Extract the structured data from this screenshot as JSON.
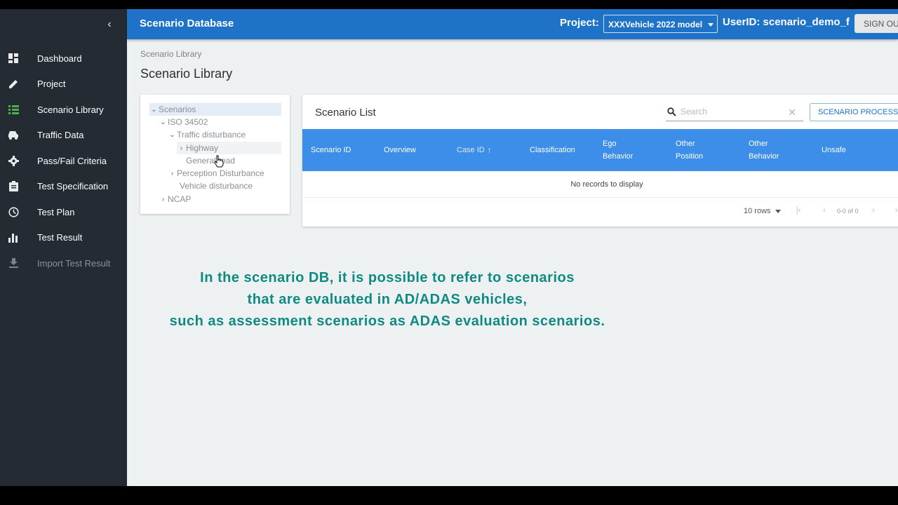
{
  "app": {
    "title": "Scenario Database"
  },
  "header": {
    "project_label": "Project:",
    "project_value": "XXXVehicle 2022 model",
    "user_id": "UserID: scenario_demo_f",
    "signout_label": "SIGN OUT"
  },
  "sidebar": {
    "collapse_icon": "chevron-left-icon",
    "items": [
      {
        "label": "Dashboard",
        "icon": "dashboard-icon"
      },
      {
        "label": "Project",
        "icon": "pencil-icon"
      },
      {
        "label": "Scenario Library",
        "icon": "list-icon",
        "active_color": "#4caf50"
      },
      {
        "label": "Traffic Data",
        "icon": "car-icon"
      },
      {
        "label": "Pass/Fail Criteria",
        "icon": "gear-icon"
      },
      {
        "label": "Test Specification",
        "icon": "clipboard-icon"
      },
      {
        "label": "Test Plan",
        "icon": "clock-icon"
      },
      {
        "label": "Test Result",
        "icon": "bar-chart-icon"
      },
      {
        "label": "Import Test Result",
        "icon": "download-icon",
        "disabled": true
      }
    ]
  },
  "breadcrumb": "Scenario Library",
  "page_title": "Scenario Library",
  "tree": {
    "nodes": [
      {
        "label": "Scenarios",
        "chevron": "expanded",
        "selected": true
      },
      {
        "label": "ISO 34502",
        "chevron": "expanded"
      },
      {
        "label": "Traffic disturbance",
        "chevron": "expanded"
      },
      {
        "label": "Highway",
        "chevron": "collapsed",
        "hovered": true
      },
      {
        "label": "General road",
        "chevron": "none"
      },
      {
        "label": "Perception Disturbance",
        "chevron": "collapsed"
      },
      {
        "label": "Vehicle disturbance",
        "chevron": "none"
      },
      {
        "label": "NCAP",
        "chevron": "collapsed"
      }
    ]
  },
  "scenario_list": {
    "title": "Scenario List",
    "search_placeholder": "Search",
    "process_button": "SCENARIO PROCESS",
    "columns": [
      {
        "line1": "Scenario ID",
        "line2": ""
      },
      {
        "line1": "Overview",
        "line2": ""
      },
      {
        "line1": "Case ID",
        "line2": "",
        "sort": "asc"
      },
      {
        "line1": "Classification",
        "line2": ""
      },
      {
        "line1": "Ego",
        "line2": "Behavior"
      },
      {
        "line1": "Other",
        "line2": "Position"
      },
      {
        "line1": "Other",
        "line2": "Behavior"
      },
      {
        "line1": "Unsafe",
        "line2": ""
      }
    ],
    "empty_message": "No records to display",
    "rows_per_page": "10 rows",
    "page_info": "0-0 of 0"
  },
  "caption": [
    "In the scenario DB, it is possible to refer to scenarios",
    "that are evaluated in AD/ADAS vehicles,",
    "such as assessment scenarios as ADAS evaluation scenarios."
  ],
  "colors": {
    "header": "#1e73c8",
    "sidebar": "#242b33",
    "table_header": "#3d8ee8",
    "caption": "#0f8a82"
  }
}
